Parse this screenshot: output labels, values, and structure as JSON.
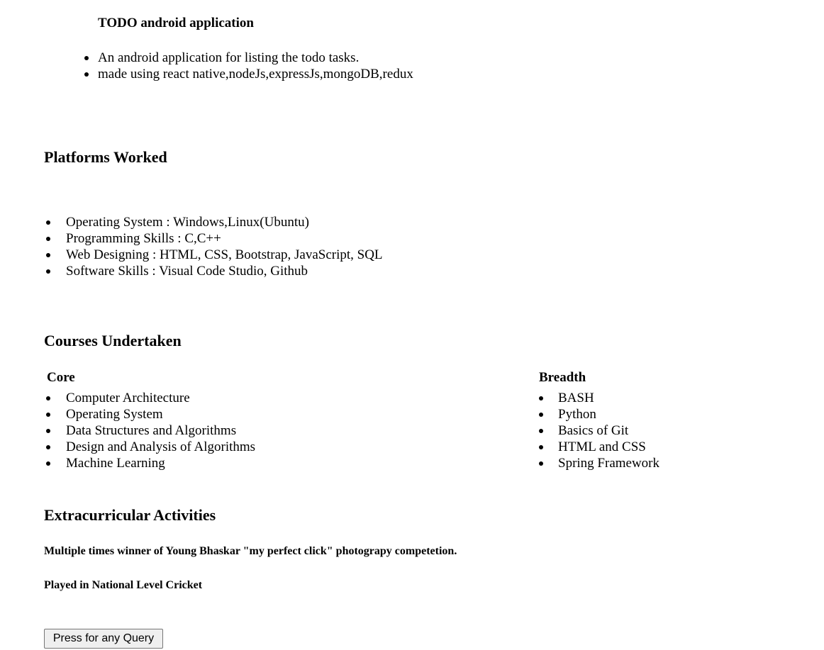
{
  "project": {
    "title": "TODO android application",
    "bullets": [
      "An android application for listing the todo tasks.",
      "made using react native,nodeJs,expressJs,mongoDB,redux"
    ]
  },
  "platforms": {
    "heading": "Platforms Worked",
    "items": [
      "Operating System : Windows,Linux(Ubuntu)",
      "Programming Skills : C,C++",
      "Web Designing : HTML, CSS, Bootstrap, JavaScript, SQL",
      "Software Skills : Visual Code Studio, Github"
    ]
  },
  "courses": {
    "heading": "Courses Undertaken",
    "core": {
      "heading": "Core",
      "items": [
        "Computer Architecture",
        "Operating System",
        "Data Structures and Algorithms",
        "Design and Analysis of Algorithms",
        "Machine Learning"
      ]
    },
    "breadth": {
      "heading": "Breadth",
      "items": [
        "BASH",
        "Python",
        "Basics of Git",
        "HTML and CSS",
        "Spring Framework"
      ]
    }
  },
  "extracurricular": {
    "heading": "Extracurricular Activities",
    "items": [
      "Multiple times winner of Young Bhaskar \"my perfect click\" photograpy competetion.",
      "Played in National Level Cricket"
    ]
  },
  "query_button": {
    "label": "Press for any Query"
  }
}
